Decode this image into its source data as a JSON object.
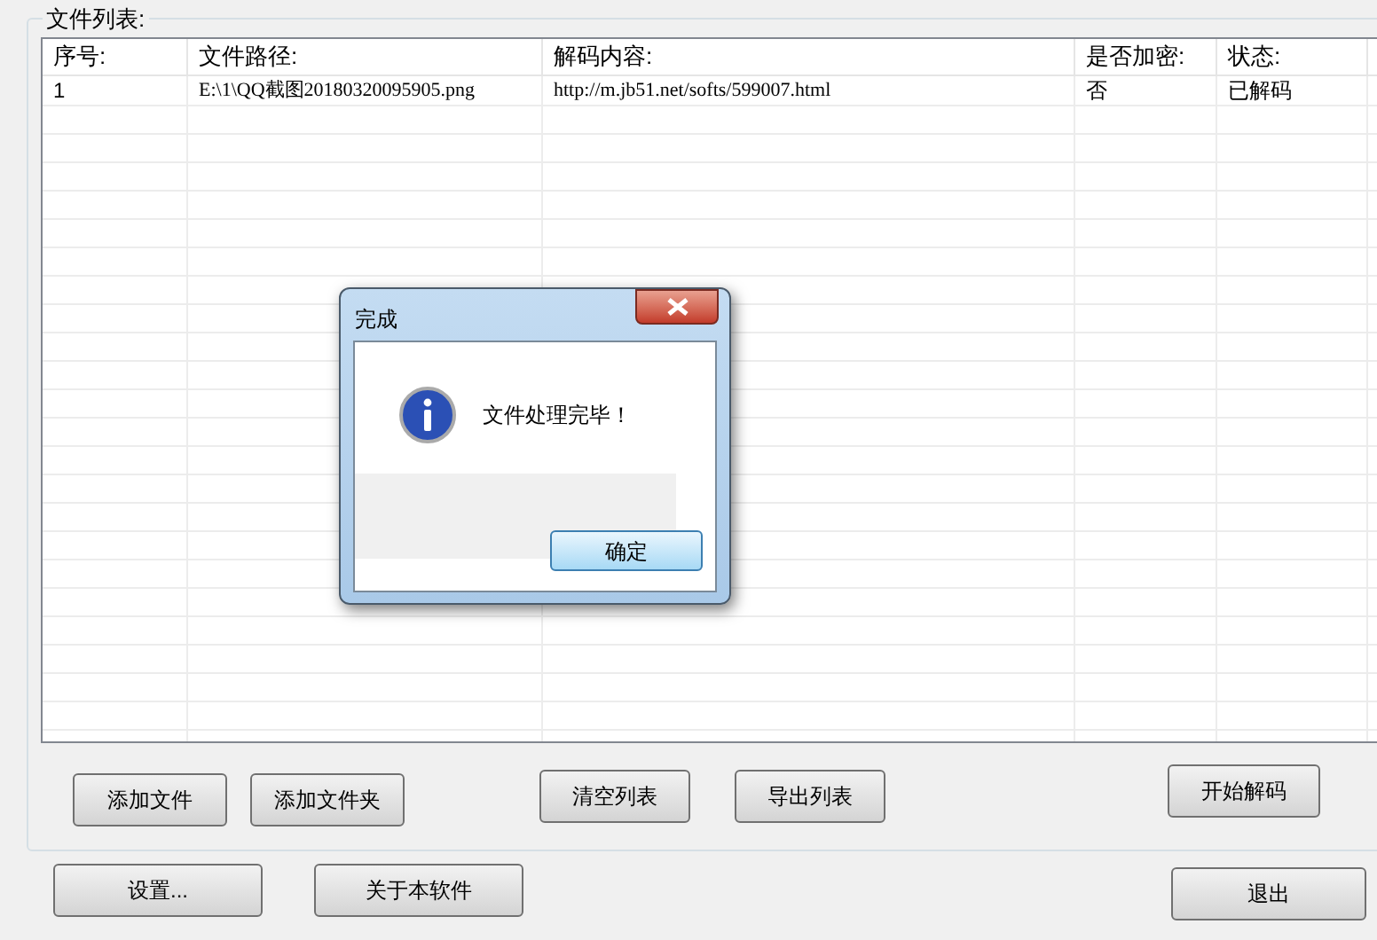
{
  "file_list": {
    "title": "文件列表:",
    "columns": [
      "序号:",
      "文件路径:",
      "解码内容:",
      "是否加密:",
      "状态:"
    ],
    "rows": [
      [
        "1",
        "E:\\1\\QQ截图20180320095905.png",
        "http://m.jb51.net/softs/599007.html",
        "否",
        "已解码"
      ]
    ],
    "buttons": [
      "添加文件",
      "添加文件夹",
      "清空列表",
      "导出列表",
      "开始解码"
    ]
  },
  "bottom_buttons": [
    "设置...",
    "关于本软件",
    "退出"
  ],
  "dialog": {
    "title": "完成",
    "message": "文件处理完毕！",
    "button": "确定"
  }
}
